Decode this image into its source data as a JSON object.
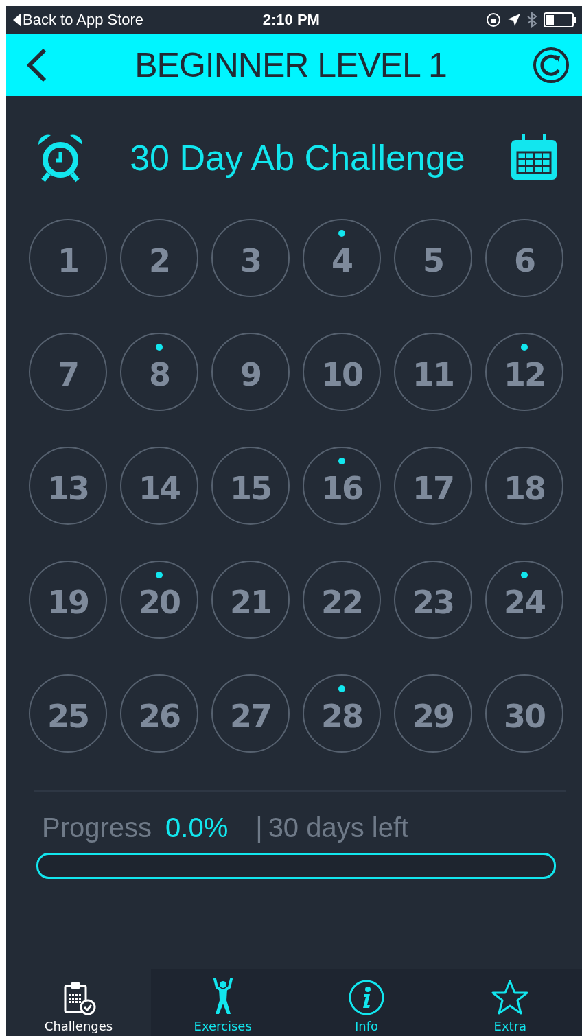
{
  "status_bar": {
    "back": "Back to App Store",
    "time": "2:10 PM"
  },
  "header": {
    "title": "BEGINNER LEVEL 1"
  },
  "challenge": {
    "title": "30 Day Ab Challenge"
  },
  "days": [
    {
      "label": "1",
      "marked": false
    },
    {
      "label": "2",
      "marked": false
    },
    {
      "label": "3",
      "marked": false
    },
    {
      "label": "4",
      "marked": true
    },
    {
      "label": "5",
      "marked": false
    },
    {
      "label": "6",
      "marked": false
    },
    {
      "label": "7",
      "marked": false
    },
    {
      "label": "8",
      "marked": true
    },
    {
      "label": "9",
      "marked": false
    },
    {
      "label": "10",
      "marked": false
    },
    {
      "label": "11",
      "marked": false
    },
    {
      "label": "12",
      "marked": true
    },
    {
      "label": "13",
      "marked": false
    },
    {
      "label": "14",
      "marked": false
    },
    {
      "label": "15",
      "marked": false
    },
    {
      "label": "16",
      "marked": true
    },
    {
      "label": "17",
      "marked": false
    },
    {
      "label": "18",
      "marked": false
    },
    {
      "label": "19",
      "marked": false
    },
    {
      "label": "20",
      "marked": true
    },
    {
      "label": "21",
      "marked": false
    },
    {
      "label": "22",
      "marked": false
    },
    {
      "label": "23",
      "marked": false
    },
    {
      "label": "24",
      "marked": true
    },
    {
      "label": "25",
      "marked": false
    },
    {
      "label": "26",
      "marked": false
    },
    {
      "label": "27",
      "marked": false
    },
    {
      "label": "28",
      "marked": true
    },
    {
      "label": "29",
      "marked": false
    },
    {
      "label": "30",
      "marked": false
    }
  ],
  "progress": {
    "label": "Progress",
    "value": "0.0%",
    "separator": "|",
    "remaining": "30 days left",
    "level": 0
  },
  "tabs": [
    {
      "label": "Challenges",
      "kind": "clipboard",
      "selected": true
    },
    {
      "label": "Exercises",
      "kind": "figure",
      "selected": false
    },
    {
      "label": "Info",
      "kind": "info",
      "selected": false
    },
    {
      "label": "Extra",
      "kind": "star",
      "selected": false
    }
  ]
}
